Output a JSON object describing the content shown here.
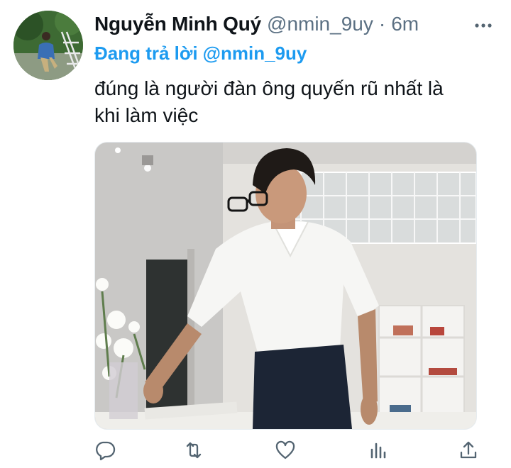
{
  "tweet": {
    "author": {
      "display_name": "Nguyễn Minh Quý",
      "handle": "@nmin_9uy",
      "avatar_icon": "profile-photo"
    },
    "separator": "·",
    "timestamp": "6m",
    "reply_context": {
      "prefix": "Đang trả lời",
      "handle": "@nmin_9uy"
    },
    "text_lines": [
      "đúng là người đàn ông quyến rũ nhất là",
      "khi làm việc"
    ],
    "media": {
      "type": "photo"
    },
    "actions": [
      {
        "name": "reply",
        "icon": "comment-icon"
      },
      {
        "name": "retweet",
        "icon": "retweet-icon"
      },
      {
        "name": "like",
        "icon": "heart-icon"
      },
      {
        "name": "analytics",
        "icon": "bar-chart-icon"
      },
      {
        "name": "share",
        "icon": "share-icon"
      }
    ],
    "colors": {
      "accent": "#1d9bf0",
      "secondary_text": "#5b7083",
      "primary_text": "#0f1419",
      "icon": "#536471"
    }
  }
}
